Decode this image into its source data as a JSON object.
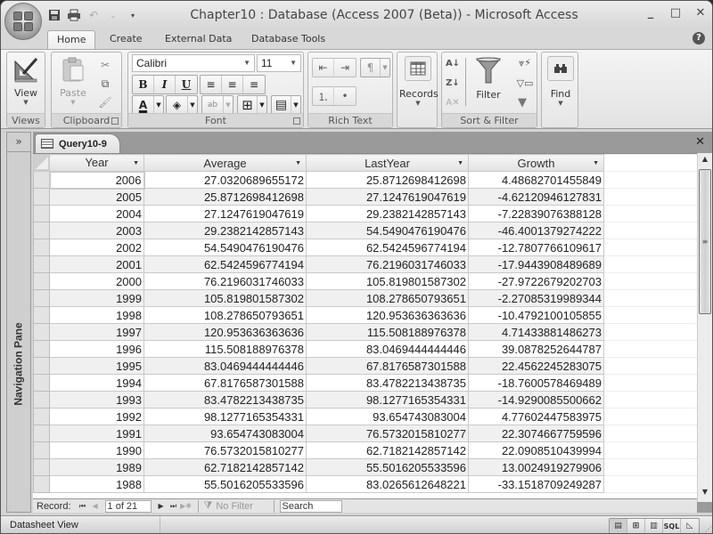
{
  "window": {
    "title": "Chapter10 : Database (Access 2007 (Beta)) - Microsoft Access",
    "controls": {
      "minimize": "_",
      "maximize": "□",
      "close": "✕"
    }
  },
  "quick_access": [
    {
      "name": "save-icon",
      "glyph": "💾"
    },
    {
      "name": "print-icon",
      "glyph": "🖶"
    },
    {
      "name": "undo-icon",
      "glyph": "↶"
    },
    {
      "name": "undo-dropdown-icon",
      "glyph": "⌄"
    },
    {
      "name": "customize-qat-icon",
      "glyph": "▾"
    }
  ],
  "ribbon_tabs": [
    "Home",
    "Create",
    "External Data",
    "Database Tools"
  ],
  "active_tab": "Home",
  "help_glyph": "?",
  "ribbon": {
    "views": {
      "label": "Views",
      "view_button": "View"
    },
    "clipboard": {
      "label": "Clipboard",
      "paste": "Paste",
      "cut_glyph": "✂",
      "copy_glyph": "⧉",
      "format_painter_glyph": "🖌"
    },
    "font": {
      "label": "Font",
      "font_name": "Calibri",
      "font_size": "11",
      "bold": "B",
      "italic": "I",
      "underline": "U",
      "align_left": "≡",
      "align_center": "≡",
      "align_right": "≡",
      "font_color_glyph": "A",
      "fill_color_glyph": "◈",
      "highlight_glyph": "ab",
      "gridlines_glyph": "⊞",
      "alt_row_glyph": "▤"
    },
    "rich_text": {
      "label": "Rich Text",
      "decrease_indent": "⇤",
      "increase_indent": "⇥",
      "paragraph": "¶",
      "numbering": "⒈",
      "bullets": "•"
    },
    "records": {
      "label": "Records"
    },
    "sort_filter": {
      "label": "Sort & Filter",
      "filter": "Filter",
      "sort_asc": "A↓",
      "sort_desc": "Z↓",
      "clear_sort": "A✕"
    },
    "find": {
      "label": "Find"
    }
  },
  "nav_pane": {
    "toggle": "»",
    "label": "Navigation Pane"
  },
  "document": {
    "tab_title": "Query10-9",
    "close_glyph": "✕",
    "columns": [
      "Year",
      "Average",
      "LastYear",
      "Growth"
    ],
    "rows": [
      [
        "2006",
        "27.0320689655172",
        "25.8712698412698",
        "4.48682701455849"
      ],
      [
        "2005",
        "25.8712698412698",
        "27.1247619047619",
        "-4.62120946127831"
      ],
      [
        "2004",
        "27.1247619047619",
        "29.2382142857143",
        "-7.22839076388128"
      ],
      [
        "2003",
        "29.2382142857143",
        "54.5490476190476",
        "-46.4001379274222"
      ],
      [
        "2002",
        "54.5490476190476",
        "62.5424596774194",
        "-12.7807766109617"
      ],
      [
        "2001",
        "62.5424596774194",
        "76.2196031746033",
        "-17.9443908489689"
      ],
      [
        "2000",
        "76.2196031746033",
        "105.819801587302",
        "-27.9722679202703"
      ],
      [
        "1999",
        "105.819801587302",
        "108.278650793651",
        "-2.27085319989344"
      ],
      [
        "1998",
        "108.278650793651",
        "120.953636363636",
        "-10.4792100105855"
      ],
      [
        "1997",
        "120.953636363636",
        "115.508188976378",
        "4.71433881486273"
      ],
      [
        "1996",
        "115.508188976378",
        "83.0469444444446",
        "39.0878252644787"
      ],
      [
        "1995",
        "83.0469444444446",
        "67.8176587301588",
        "22.4562245283075"
      ],
      [
        "1994",
        "67.8176587301588",
        "83.4782213438735",
        "-18.7600578469489"
      ],
      [
        "1993",
        "83.4782213438735",
        "98.1277165354331",
        "-14.9290085500662"
      ],
      [
        "1992",
        "98.1277165354331",
        "93.654743083004",
        "4.77602447583975"
      ],
      [
        "1991",
        "93.654743083004",
        "76.5732015810277",
        "22.3074667759596"
      ],
      [
        "1990",
        "76.5732015810277",
        "62.7182142857142",
        "22.0908510439994"
      ],
      [
        "1989",
        "62.7182142857142",
        "55.5016205533596",
        "13.0024919279906"
      ],
      [
        "1988",
        "55.5016205533596",
        "83.0265612648221",
        "-33.1518709249287"
      ]
    ]
  },
  "record_nav": {
    "label": "Record:",
    "first": "⏮",
    "prev": "◀",
    "current": "1 of 21",
    "next": "▶",
    "last": "⏭",
    "new": "▶✱",
    "filter_status": "No Filter",
    "search_value": "Search"
  },
  "status_bar": {
    "text": "Datasheet View",
    "views": [
      "datasheet-view",
      "pivottable-view",
      "pivotchart-view",
      "sql-view",
      "design-view"
    ],
    "sql_label": "SQL"
  }
}
